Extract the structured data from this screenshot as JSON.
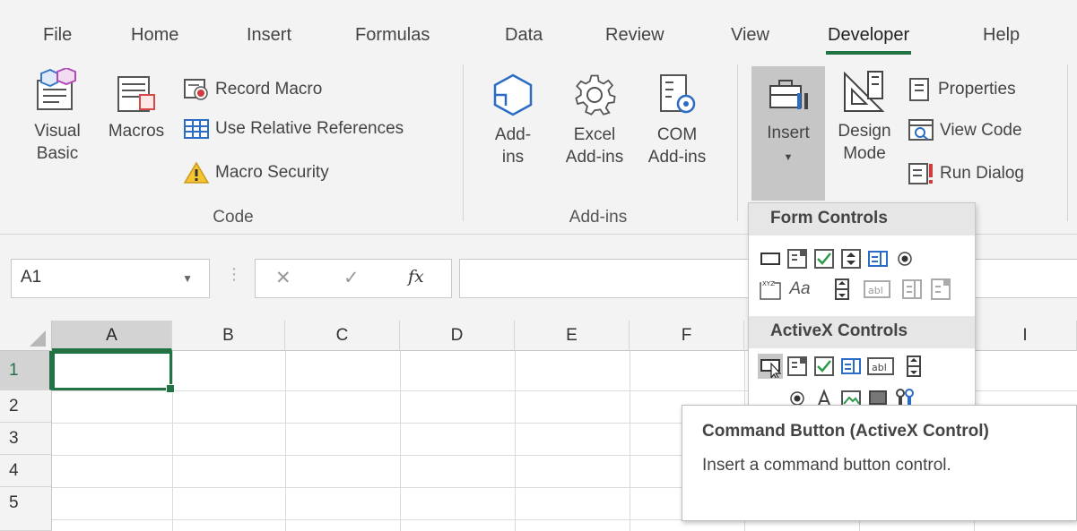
{
  "tabs": [
    "File",
    "Home",
    "Insert",
    "Formulas",
    "Data",
    "Review",
    "View",
    "Developer",
    "Help"
  ],
  "active_tab": "Developer",
  "code_group": {
    "label": "Code",
    "visual_basic": [
      "Visual",
      "Basic"
    ],
    "macros": "Macros",
    "record_macro": "Record Macro",
    "use_relative": "Use Relative References",
    "macro_security": "Macro Security"
  },
  "addins_group": {
    "label": "Add-ins",
    "addins": [
      "Add-",
      "ins"
    ],
    "excel_addins": [
      "Excel",
      "Add-ins"
    ],
    "com_addins": [
      "COM",
      "Add-ins"
    ]
  },
  "controls_group": {
    "insert": "Insert",
    "design_mode": [
      "Design",
      "Mode"
    ],
    "properties": "Properties",
    "view_code": "View Code",
    "run_dialog": "Run Dialog"
  },
  "namebox": {
    "value": "A1"
  },
  "formula_bar": {
    "fx": "fx",
    "value": ""
  },
  "columns": [
    "A",
    "B",
    "C",
    "D",
    "E",
    "F",
    "I"
  ],
  "rows": [
    "1",
    "2",
    "3",
    "4",
    "5"
  ],
  "active_cell": "A1",
  "insert_dropdown": {
    "form_controls_label": "Form Controls",
    "activex_controls_label": "ActiveX Controls",
    "xyz_label": "XYZ",
    "aa_label": "Aa",
    "abl_label": "abl"
  },
  "tooltip": {
    "title": "Command Button (ActiveX Control)",
    "description": "Insert a command button control."
  },
  "colors": {
    "accent": "#217346",
    "ribbon_bg": "#f3f3f3",
    "selected_header": "#d3d3d3"
  }
}
